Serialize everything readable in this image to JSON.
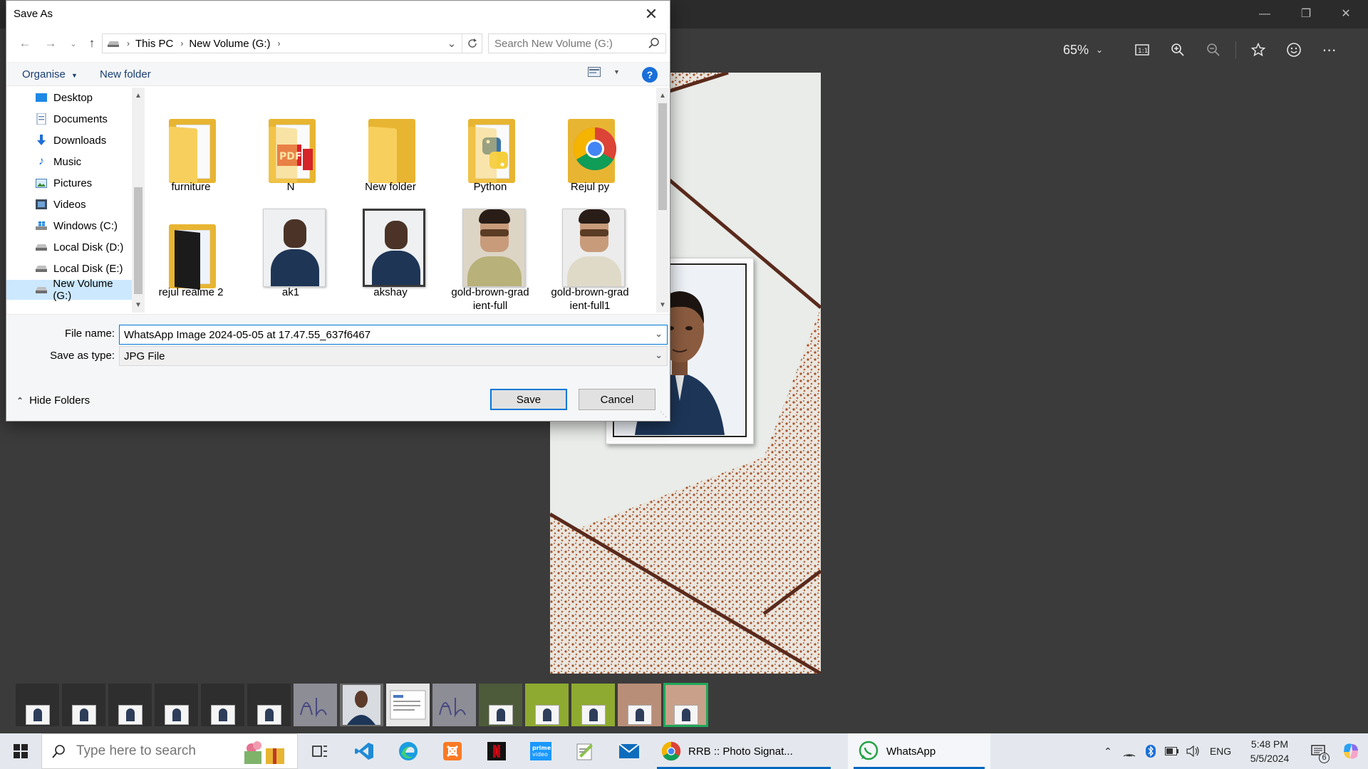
{
  "viewer": {
    "zoom": "65%",
    "window_controls": [
      "minimize",
      "restore",
      "close"
    ],
    "toolbar_icons": [
      "actual-size-icon",
      "zoom-in-icon",
      "zoom-out-icon",
      "favorite-icon",
      "feedback-icon",
      "more-icon"
    ]
  },
  "dialog": {
    "title": "Save As",
    "address": {
      "crumbs": [
        "This PC",
        "New Volume (G:)"
      ]
    },
    "search_placeholder": "Search New Volume (G:)",
    "commands": {
      "organise": "Organise",
      "new_folder": "New folder",
      "help": "?"
    },
    "nav_items": [
      {
        "label": "Desktop",
        "icon": "desktop-icon"
      },
      {
        "label": "Documents",
        "icon": "documents-icon"
      },
      {
        "label": "Downloads",
        "icon": "downloads-icon"
      },
      {
        "label": "Music",
        "icon": "music-icon"
      },
      {
        "label": "Pictures",
        "icon": "pictures-icon"
      },
      {
        "label": "Videos",
        "icon": "videos-icon"
      },
      {
        "label": "Windows (C:)",
        "icon": "windows-drive-icon"
      },
      {
        "label": "Local Disk (D:)",
        "icon": "drive-icon"
      },
      {
        "label": "Local Disk (E:)",
        "icon": "drive-icon"
      },
      {
        "label": "New Volume (G:)",
        "icon": "drive-icon",
        "selected": true
      }
    ],
    "files": [
      {
        "name": "furniture",
        "kind": "folder"
      },
      {
        "name": "N",
        "kind": "folder-pdf"
      },
      {
        "name": "New folder",
        "kind": "folder"
      },
      {
        "name": "Python",
        "kind": "folder-python"
      },
      {
        "name": "Rejul py",
        "kind": "folder-chrome"
      },
      {
        "name": "rejul realme 2",
        "kind": "folder-dark"
      },
      {
        "name": "ak1",
        "kind": "photo"
      },
      {
        "name": "akshay",
        "kind": "photo"
      },
      {
        "name": "gold-brown-grad ient-full",
        "kind": "model-photo"
      },
      {
        "name": "gold-brown-grad ient-full1",
        "kind": "model-photo"
      }
    ],
    "file_name_label": "File name:",
    "file_name_value": "WhatsApp Image 2024-05-05 at 17.47.55_637f6467",
    "save_type_label": "Save as type:",
    "save_type_value": "JPG File",
    "hide_folders": "Hide Folders",
    "save_button": "Save",
    "cancel_button": "Cancel"
  },
  "taskbar": {
    "search_placeholder": "Type here to search",
    "apps": [
      {
        "name": "task-view",
        "label": ""
      },
      {
        "name": "vscode",
        "label": ""
      },
      {
        "name": "edge",
        "label": ""
      },
      {
        "name": "xampp",
        "label": ""
      },
      {
        "name": "netflix",
        "label": ""
      },
      {
        "name": "prime-video",
        "label": ""
      },
      {
        "name": "notepad-plus",
        "label": ""
      },
      {
        "name": "mail",
        "label": ""
      }
    ],
    "chrome_window": "RRB :: Photo Signat...",
    "whatsapp_window": "WhatsApp",
    "language": "ENG",
    "time": "5:48 PM",
    "date": "5/5/2024",
    "notification_count": "6"
  },
  "colors": {
    "accent": "#0078d7",
    "folder_yellow": "#e8b532",
    "taskbar_bg": "#e4e8ee",
    "viewer_bg": "#3b3b3b",
    "filmstrip_selected": "#1fa85a"
  }
}
